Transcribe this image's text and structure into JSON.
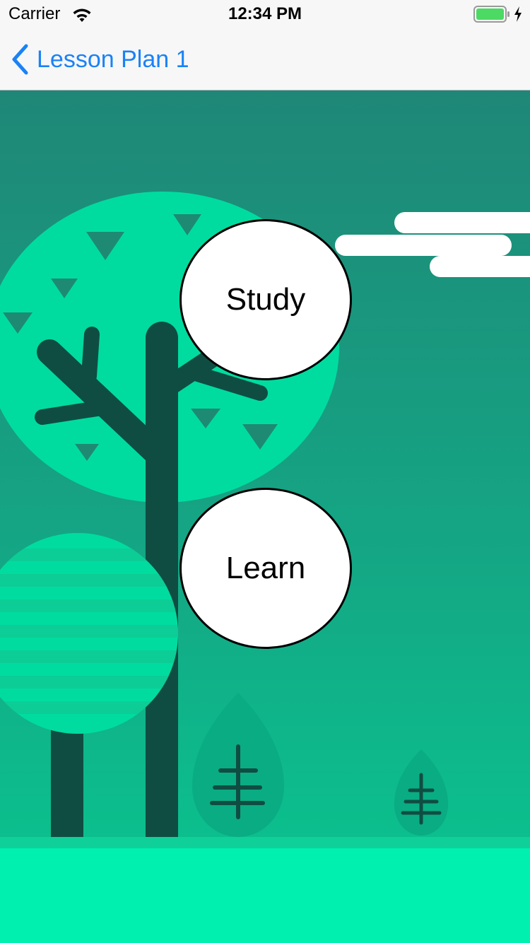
{
  "status_bar": {
    "carrier": "Carrier",
    "time": "12:34 PM",
    "wifi_icon": "wifi-icon",
    "battery_icon": "battery-icon",
    "charging_icon": "charging-bolt-icon",
    "battery_level": 1.0
  },
  "nav": {
    "back_label": "Lesson Plan 1",
    "back_icon": "chevron-left-icon"
  },
  "actions": {
    "study_label": "Study",
    "learn_label": "Learn"
  },
  "colors": {
    "accent": "#1a82f7",
    "sky_top": "#1f8777",
    "sky_bottom": "#08c890",
    "ground": "#00f0b0",
    "tree_foliage": "#00dca0",
    "trunk": "#0f4d42",
    "battery_fill": "#4cd964"
  }
}
